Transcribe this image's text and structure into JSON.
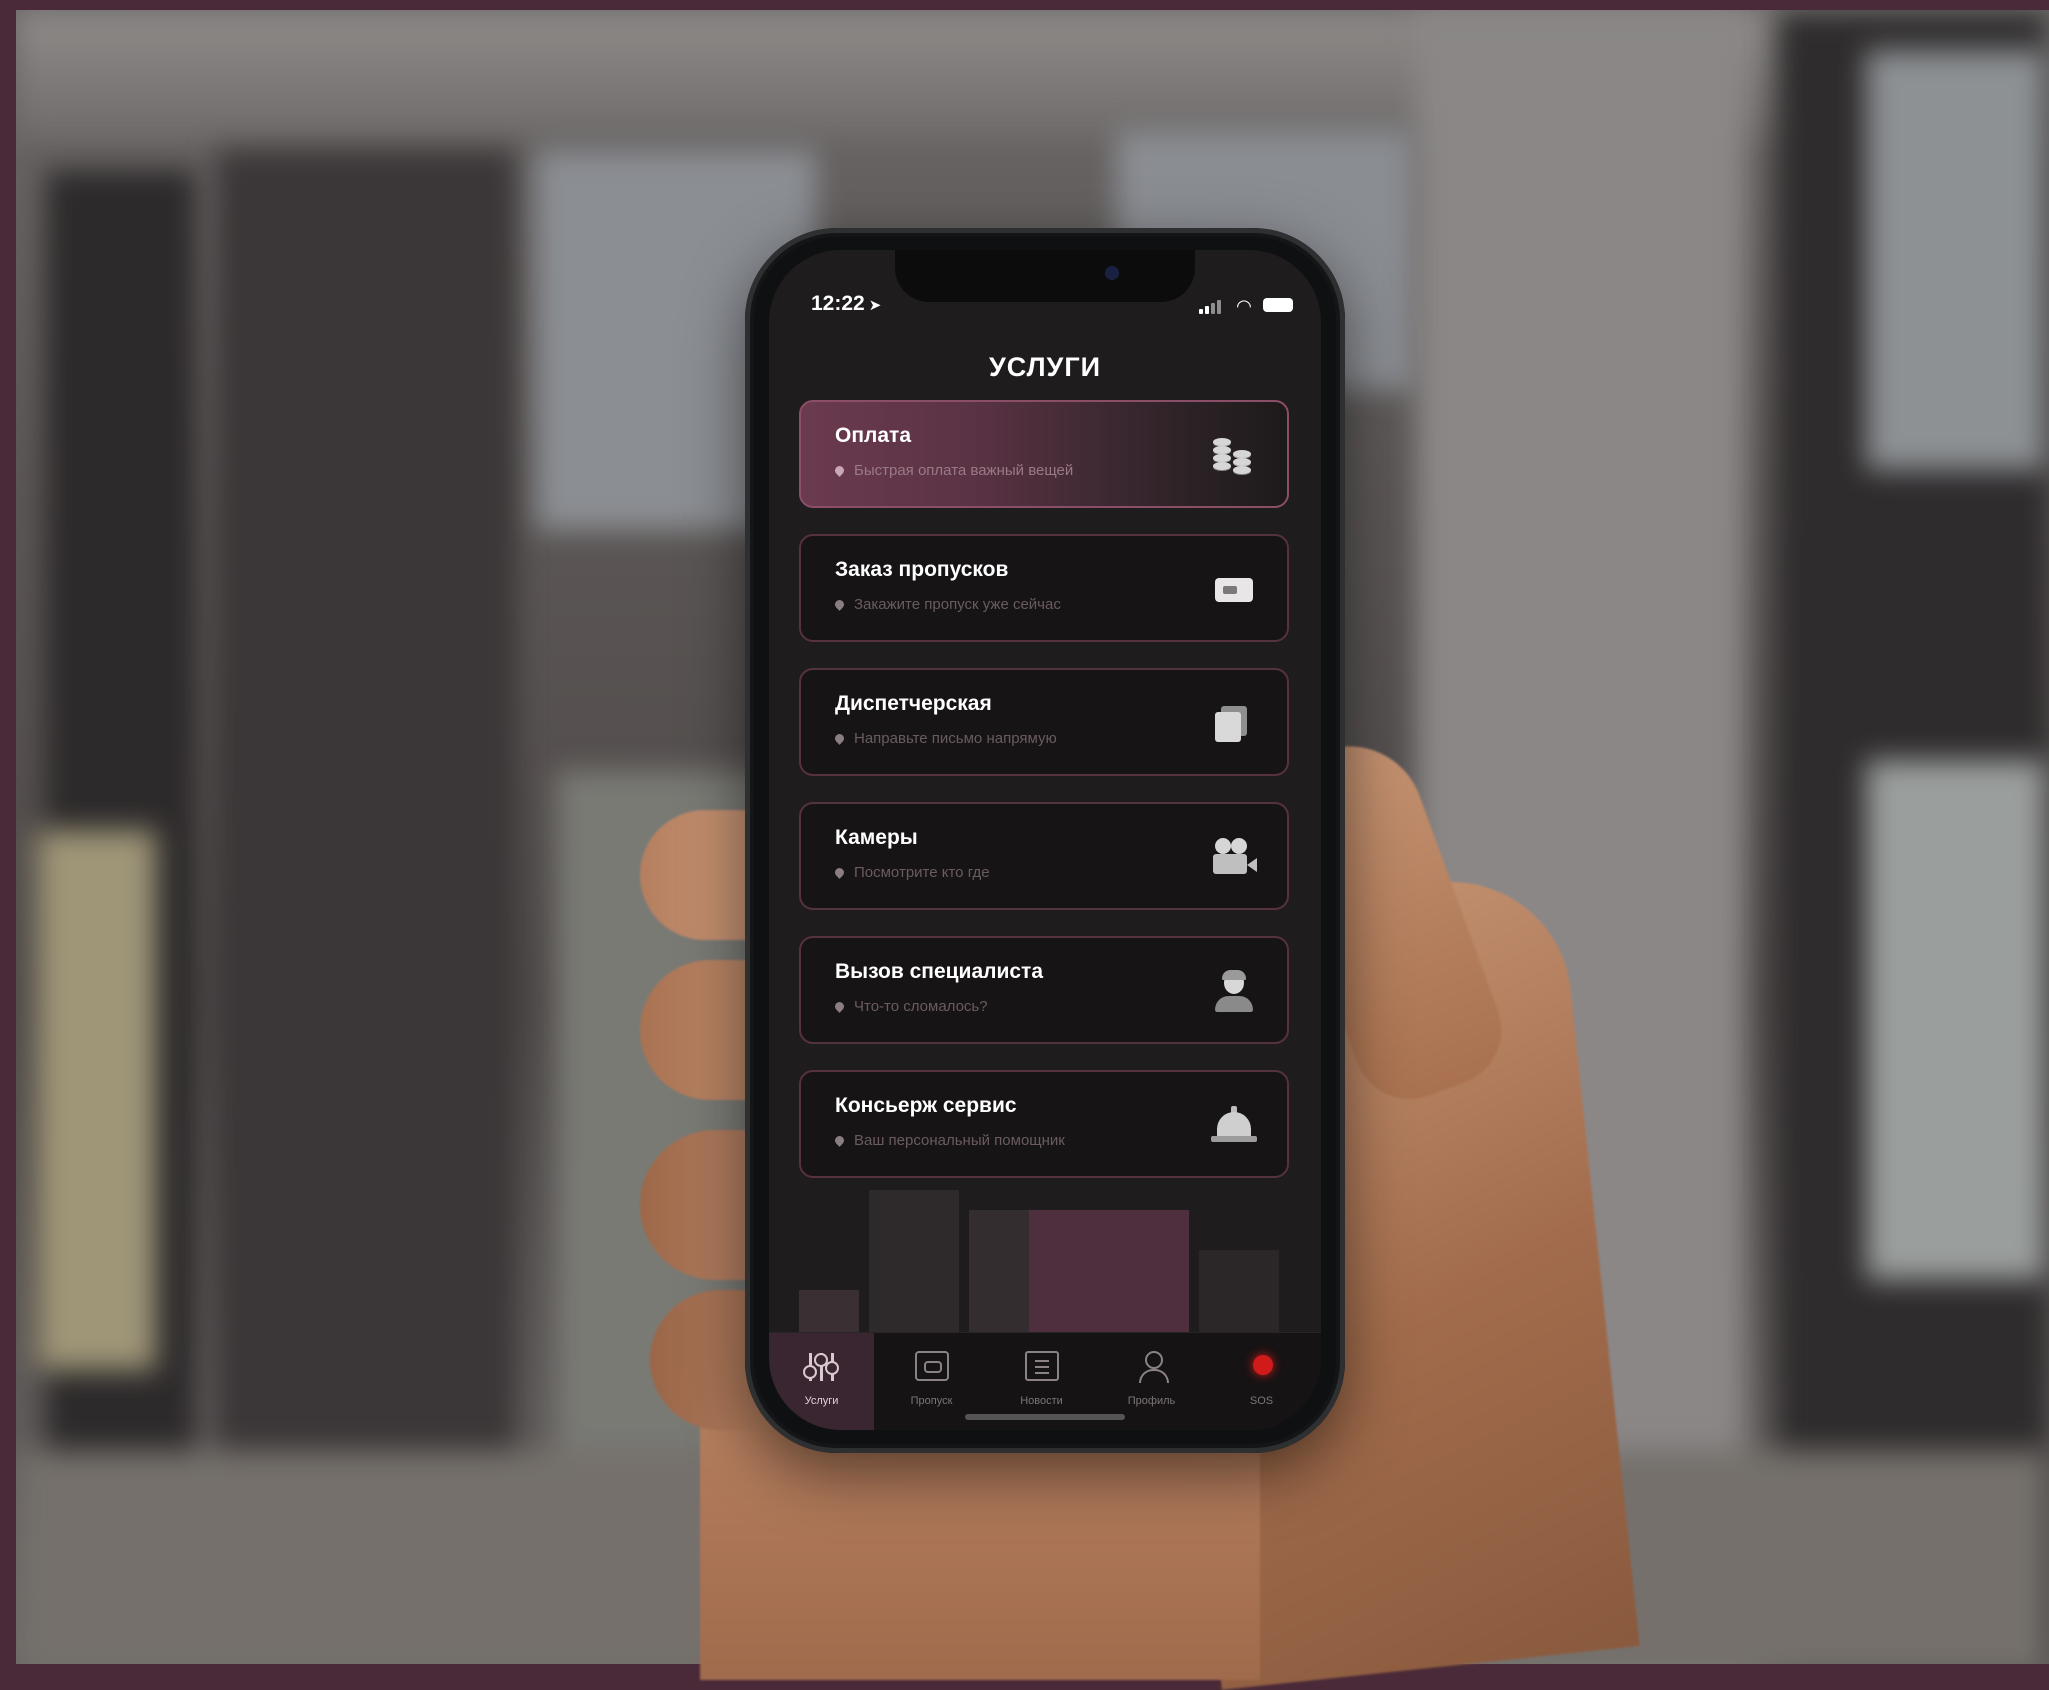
{
  "status_bar": {
    "time": "12:22",
    "location_arrow": "location-arrow-icon",
    "signal_icon": "cellular-signal-icon",
    "wifi_icon": "wifi-icon",
    "battery_icon": "battery-icon"
  },
  "header": {
    "title": "УСЛУГИ"
  },
  "services": [
    {
      "title": "Оплата",
      "subtitle": "Быстрая оплата важный вещей",
      "icon": "coins-icon",
      "active": true
    },
    {
      "title": "Заказ пропусков",
      "subtitle": "Закажите пропуск уже сейчас",
      "icon": "pass-card-icon",
      "active": false
    },
    {
      "title": "Диспетчерская",
      "subtitle": "Направьте письмо напрямую",
      "icon": "documents-icon",
      "active": false
    },
    {
      "title": "Камеры",
      "subtitle": "Посмотрите кто где",
      "icon": "movie-camera-icon",
      "active": false
    },
    {
      "title": "Вызов специалиста",
      "subtitle": "Что-то сломалось?",
      "icon": "specialist-icon",
      "active": false
    },
    {
      "title": "Консьерж сервис",
      "subtitle": "Ваш персональный помощник",
      "icon": "concierge-bell-icon",
      "active": false
    }
  ],
  "tabbar": [
    {
      "label": "Услуги",
      "icon": "sliders-icon",
      "active": true
    },
    {
      "label": "Пропуск",
      "icon": "pass-icon",
      "active": false
    },
    {
      "label": "Новости",
      "icon": "news-icon",
      "active": false
    },
    {
      "label": "Профиль",
      "icon": "profile-icon",
      "active": false
    },
    {
      "label": "SOS",
      "icon": "sos-icon",
      "active": false
    }
  ],
  "colors": {
    "accent": "#6b3a4f",
    "screen_bg": "#1f1c1d",
    "card_border": "#563140",
    "sos": "#d11b1b",
    "frame": "#4a2a38"
  }
}
